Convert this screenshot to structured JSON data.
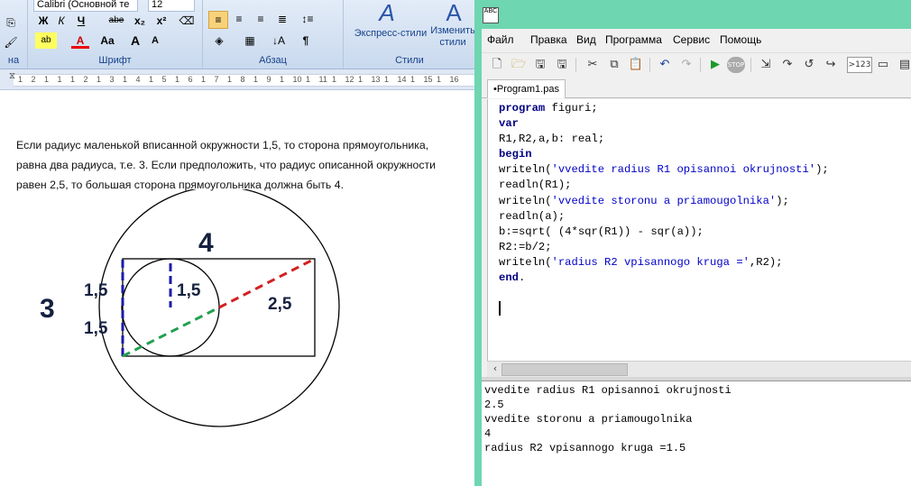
{
  "word": {
    "font_name": "Calibri (Основной те",
    "font_size": "12",
    "groups": {
      "font_label": "Шрифт",
      "paragraph_label": "Абзац",
      "styles_label": "Стили",
      "left_stub": "на"
    },
    "buttons": {
      "bold": "Ж",
      "italic": "К",
      "underline": "Ч",
      "strike": "abe",
      "subscript": "x₂",
      "superscript": "x²",
      "case": "Aa",
      "grow": "A",
      "shrink": "A",
      "express_styles": "Экспресс-стили",
      "change_styles": "Изменить стили"
    },
    "ruler_numbers": [
      "1",
      "2",
      "1",
      "1",
      "1",
      "2",
      "1",
      "3",
      "1",
      "4",
      "1",
      "5",
      "1",
      "6",
      "1",
      "7",
      "1",
      "8",
      "1",
      "9",
      "1",
      "10",
      "1",
      "11",
      "1",
      "12",
      "1",
      "13",
      "1",
      "14",
      "1",
      "15",
      "1",
      "16"
    ],
    "paragraph": [
      "Если радиус маленькой вписанной окружности 1,5, то сторона  прямоугольника,",
      "равна два радиуса, т.е. 3.  Если предположить, что радиус описанной окружности",
      "равен 2,5, то большая сторона прямоугольника должна быть 4."
    ],
    "figure": {
      "label_top": "4",
      "label_left": "3",
      "label_left_upper": "1,5",
      "label_left_lower": "1,5",
      "label_inner_radius": "1,5",
      "label_diagonal": "2,5"
    }
  },
  "ide": {
    "icon_text": "ABC",
    "menu": [
      "Файл",
      "Правка",
      "Вид",
      "Программа",
      "Сервис",
      "Помощь"
    ],
    "toolbar_counter": ">123",
    "tab_label": "•Program1.pas",
    "code_lines": [
      "program figuri;",
      "var",
      "R1,R2,a,b: real;",
      "begin",
      "writeln('vvedite radius R1 opisannoi okrujnosti');",
      "readln(R1);",
      "writeln('vvedite storonu a priamougolnika');",
      "readln(a);",
      "b:=sqrt( (4*sqr(R1)) - sqr(a));",
      "R2:=b/2;",
      "writeln('radius R2 vpisannogo kruga =',R2);",
      "end."
    ],
    "output_lines": [
      "vvedite radius R1 opisannoi okrujnosti",
      "2.5",
      "vvedite storonu a priamougolnika",
      "4",
      "radius R2 vpisannogo kruga =1.5"
    ]
  },
  "colors": {
    "ide_frame": "#6ed6b0",
    "keyword": "#000080",
    "string": "#0000c8",
    "blue_dash": "#1a1aaa",
    "green_dash": "#22a050",
    "red_dash": "#d42020"
  }
}
